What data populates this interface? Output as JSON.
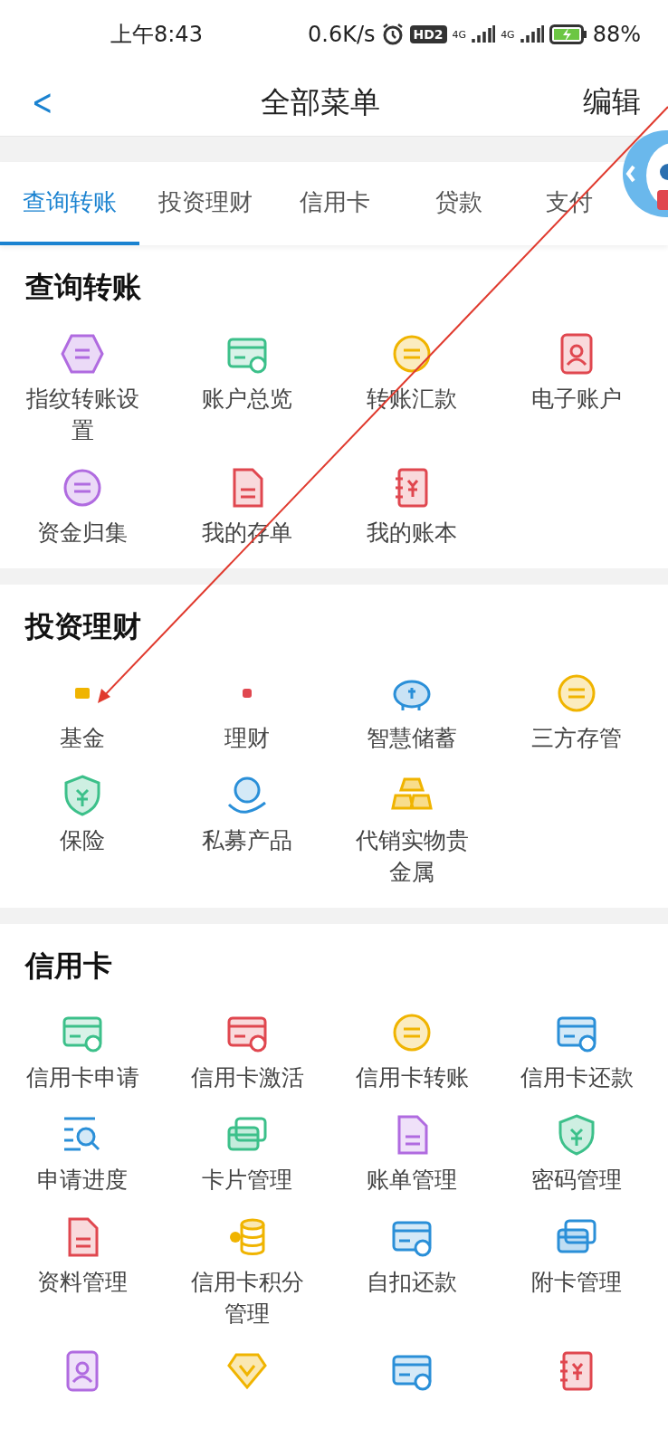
{
  "status_bar": {
    "time": "上午8:43",
    "speed": "0.6K/s",
    "hd": "HD2",
    "net1": "4G",
    "net2": "4G",
    "battery": "88%"
  },
  "header": {
    "back": "<",
    "title": "全部菜单",
    "action": "编辑"
  },
  "tabs": [
    {
      "label": "查询转账",
      "selected": true
    },
    {
      "label": "投资理财",
      "selected": false
    },
    {
      "label": "信用卡",
      "selected": false
    },
    {
      "label": "贷款",
      "selected": false
    },
    {
      "label": "支付",
      "selected": false
    }
  ],
  "sections": [
    {
      "title": "查询转账",
      "items": [
        {
          "label": "指纹转账设置",
          "kind": "hexagon",
          "color": "#b06be0"
        },
        {
          "label": "账户总览",
          "kind": "card",
          "color": "#3cc08a"
        },
        {
          "label": "转账汇款",
          "kind": "coin",
          "color": "#f0b400"
        },
        {
          "label": "电子账户",
          "kind": "badge",
          "color": "#e0474f"
        },
        {
          "label": "资金归集",
          "kind": "coin",
          "color": "#b06be0"
        },
        {
          "label": "我的存单",
          "kind": "doc",
          "color": "#e0474f"
        },
        {
          "label": "我的账本",
          "kind": "book",
          "color": "#e0474f"
        }
      ]
    },
    {
      "title": "投资理财",
      "items": [
        {
          "label": "基金",
          "kind": "tiny-card",
          "color": "#f0b400"
        },
        {
          "label": "理财",
          "kind": "tiny-dot",
          "color": "#e0474f"
        },
        {
          "label": "智慧储蓄",
          "kind": "piggy",
          "color": "#2a8fd8"
        },
        {
          "label": "三方存管",
          "kind": "coin",
          "color": "#f0b400"
        },
        {
          "label": "保险",
          "kind": "shield",
          "color": "#3cc08a"
        },
        {
          "label": "私募产品",
          "kind": "hand",
          "color": "#2a8fd8"
        },
        {
          "label": "代销实物贵金属",
          "kind": "gold",
          "color": "#f0b400"
        }
      ]
    },
    {
      "title": "信用卡",
      "items": [
        {
          "label": "信用卡申请",
          "kind": "card",
          "color": "#3cc08a"
        },
        {
          "label": "信用卡激活",
          "kind": "card",
          "color": "#e0474f"
        },
        {
          "label": "信用卡转账",
          "kind": "coin",
          "color": "#f0b400"
        },
        {
          "label": "信用卡还款",
          "kind": "card",
          "color": "#2a8fd8"
        },
        {
          "label": "申请进度",
          "kind": "search",
          "color": "#2a8fd8"
        },
        {
          "label": "卡片管理",
          "kind": "cards",
          "color": "#3cc08a"
        },
        {
          "label": "账单管理",
          "kind": "doc",
          "color": "#b06be0"
        },
        {
          "label": "密码管理",
          "kind": "shield",
          "color": "#3cc08a"
        },
        {
          "label": "资料管理",
          "kind": "doc",
          "color": "#e0474f"
        },
        {
          "label": "信用卡积分管理",
          "kind": "stack",
          "color": "#f0b400"
        },
        {
          "label": "自扣还款",
          "kind": "card",
          "color": "#2a8fd8"
        },
        {
          "label": "附卡管理",
          "kind": "cards",
          "color": "#2a8fd8"
        },
        {
          "kind": "badge",
          "color": "#b06be0"
        },
        {
          "kind": "diamond",
          "color": "#f0b400"
        },
        {
          "kind": "card",
          "color": "#2a8fd8"
        },
        {
          "kind": "book",
          "color": "#e0474f"
        }
      ]
    }
  ]
}
